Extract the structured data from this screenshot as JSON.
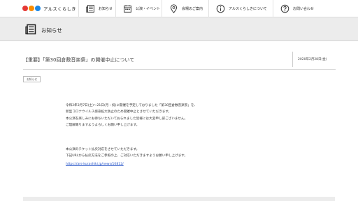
{
  "nav": {
    "logo_text": "アルスくらしき",
    "items": [
      {
        "label": "お知らせ",
        "icon": "newspaper-icon"
      },
      {
        "label": "公演・イベント",
        "icon": "calendar-icon"
      },
      {
        "label": "会場のご案内",
        "icon": "map-pin-icon"
      },
      {
        "label": "アルスくらしきについて",
        "icon": "info-icon"
      },
      {
        "label": "お問い合わせ",
        "icon": "question-icon"
      }
    ]
  },
  "page": {
    "title": "お知らせ"
  },
  "article": {
    "title": "【重要】「第30回倉敷音楽祭」の開催中止について",
    "date": "2020年2月28日(金)",
    "tag": "お知らせ",
    "paragraph1": [
      "令和2年3月7日(土)〜21日(月・祝)に開催を予定しておりました「第30回倉敷音楽祭」を、",
      "新型コロナウイルス感染拡大防止のため開催中止とさせていただきます。",
      "本公演を楽しみにお待ちいただいておられました皆様には大変申し訳ございません。",
      "ご理解賜りますようよろしくお願い申し上げます。"
    ],
    "paragraph2": [
      "本公演のチケット払戻対応をさせていただきます。",
      "下記URLから払戻方法をご参照の上、ご対応いただきますようお願い申し上げます。"
    ],
    "link": "https://ars-kurashiki.jp/news/10812/"
  },
  "colors": {
    "logo_red": "#e53935",
    "logo_orange": "#fb8c00",
    "logo_blue": "#1e88e5",
    "link": "#2b58c9",
    "band": "#ececec"
  }
}
